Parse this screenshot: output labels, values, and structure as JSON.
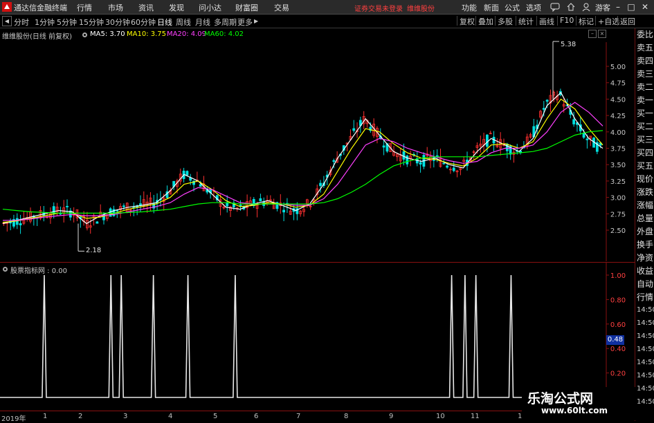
{
  "app": {
    "title": "通达信金融终端",
    "menu": [
      "行情",
      "市场",
      "资讯",
      "发现",
      "问小达",
      "财富圈",
      "交易"
    ],
    "warning": "证券交易未登录",
    "warning2": "维维股份",
    "right_menu": [
      "功能",
      "新面",
      "公式",
      "选项"
    ],
    "guest": "游客",
    "window_buttons": [
      "minimize",
      "maximize",
      "close"
    ]
  },
  "toolbar": {
    "back": "◀",
    "periods": [
      "分时",
      "1分钟",
      "5分钟",
      "15分钟",
      "30分钟",
      "60分钟",
      "日线",
      "周线",
      "月线",
      "多周期",
      "更多"
    ],
    "active_period": "日线",
    "buttons": [
      "复权",
      "叠加",
      "多股",
      "统计",
      "画线",
      "F10",
      "标记",
      "+自选",
      "返回"
    ]
  },
  "main_legend": {
    "stock": "维维股份(日线 前复权)",
    "ma5": "MA5: 3.70",
    "ma10": "MA10: 3.75",
    "ma20": "MA20: 4.09",
    "ma60": "MA60: 4.02",
    "colors": {
      "ma5": "#ffffff",
      "ma10": "#ffff00",
      "ma20": "#ff40ff",
      "ma60": "#00ff00"
    }
  },
  "sub_legend": {
    "name": "股票指标网 : 0.00"
  },
  "annotations": {
    "high": "5.38",
    "low": "2.18",
    "current_sub": "0.48"
  },
  "right_panel": [
    "委比",
    "卖五",
    "卖四",
    "卖三",
    "卖二",
    "卖一",
    "买一",
    "买二",
    "买三",
    "买四",
    "买五",
    "现价",
    "涨跌",
    "涨幅",
    "总量",
    "外盘",
    "换手",
    "净资",
    "收益",
    "自动",
    "行情",
    "14:50",
    "14:50",
    "14:50",
    "14:50",
    "14:50",
    "14:50",
    "14:50",
    "14:50"
  ],
  "x_axis": [
    "2019年",
    "1",
    "2",
    "3",
    "4",
    "5",
    "6",
    "7",
    "8",
    "9",
    "10",
    "11",
    "1"
  ],
  "watermark": {
    "line1": "乐淘公式网",
    "line2": "www.60lt.com"
  },
  "chart_data": [
    {
      "type": "line",
      "title": "维维股份(日线 前复权)",
      "y_ticks": [
        5.0,
        4.75,
        4.5,
        4.25,
        4.0,
        3.75,
        3.5,
        3.25,
        3.0,
        2.75,
        2.5
      ],
      "ylim": [
        2.18,
        5.38
      ],
      "series": [
        {
          "name": "MA5",
          "color": "#ffffff",
          "values": [
            2.6,
            2.65,
            2.7,
            2.75,
            2.8,
            2.78,
            2.6,
            2.72,
            2.8,
            2.85,
            2.88,
            2.92,
            3.1,
            3.35,
            3.25,
            3.05,
            2.85,
            2.82,
            2.9,
            2.95,
            2.88,
            2.8,
            2.9,
            3.2,
            3.6,
            3.9,
            4.2,
            3.95,
            3.7,
            3.6,
            3.55,
            3.6,
            3.5,
            3.45,
            3.7,
            3.9,
            3.8,
            3.7,
            3.9,
            4.4,
            4.6,
            4.2,
            3.9,
            3.75
          ]
        },
        {
          "name": "MA10",
          "color": "#ffff00",
          "values": [
            2.62,
            2.64,
            2.68,
            2.72,
            2.76,
            2.76,
            2.68,
            2.7,
            2.76,
            2.82,
            2.86,
            2.9,
            3.0,
            3.2,
            3.25,
            3.12,
            2.95,
            2.86,
            2.88,
            2.92,
            2.9,
            2.85,
            2.88,
            3.05,
            3.4,
            3.75,
            4.05,
            4.0,
            3.82,
            3.68,
            3.6,
            3.58,
            3.52,
            3.48,
            3.6,
            3.8,
            3.82,
            3.75,
            3.85,
            4.2,
            4.5,
            4.35,
            4.05,
            3.8
          ]
        },
        {
          "name": "MA20",
          "color": "#ff40ff",
          "values": [
            2.65,
            2.65,
            2.67,
            2.7,
            2.72,
            2.74,
            2.72,
            2.72,
            2.74,
            2.78,
            2.82,
            2.86,
            2.92,
            3.05,
            3.15,
            3.12,
            3.02,
            2.92,
            2.9,
            2.9,
            2.9,
            2.88,
            2.88,
            2.98,
            3.2,
            3.5,
            3.8,
            3.9,
            3.85,
            3.75,
            3.68,
            3.62,
            3.56,
            3.52,
            3.55,
            3.68,
            3.75,
            3.75,
            3.8,
            4.0,
            4.3,
            4.45,
            4.3,
            4.09
          ]
        },
        {
          "name": "MA60",
          "color": "#00ff00",
          "values": [
            2.82,
            2.8,
            2.78,
            2.77,
            2.76,
            2.76,
            2.76,
            2.76,
            2.76,
            2.77,
            2.78,
            2.8,
            2.82,
            2.86,
            2.9,
            2.92,
            2.92,
            2.9,
            2.9,
            2.9,
            2.9,
            2.9,
            2.9,
            2.92,
            2.98,
            3.08,
            3.2,
            3.35,
            3.48,
            3.55,
            3.6,
            3.62,
            3.62,
            3.62,
            3.62,
            3.64,
            3.66,
            3.68,
            3.7,
            3.75,
            3.85,
            3.95,
            4.0,
            4.02
          ]
        }
      ]
    },
    {
      "type": "line",
      "title": "股票指标网",
      "y_ticks": [
        1.0,
        0.8,
        0.6,
        0.4,
        0.2
      ],
      "ylim": [
        0,
        1
      ],
      "spikes_x_fraction": [
        0.073,
        0.183,
        0.2,
        0.253,
        0.31,
        0.388,
        0.745,
        0.767,
        0.785,
        0.843
      ],
      "series": [
        {
          "name": "股票指标网",
          "color": "#ffffff",
          "values": [
            0,
            0,
            0,
            0,
            0,
            0,
            0,
            0,
            0,
            0,
            0,
            0
          ]
        }
      ]
    }
  ]
}
